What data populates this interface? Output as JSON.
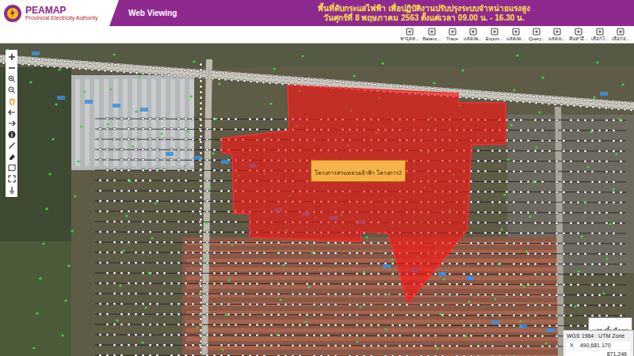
{
  "header": {
    "logo": "PEAMAP",
    "org": "Provincial Electricity Authority",
    "app": "Web Viewing",
    "title_line1": "พื้นที่ดับกระแสไฟฟ้า เพื่อปฏิบัติงานปรับปรุงระบบจำหน่ายแรงสูง",
    "title_line2": "วันศุกร์ที่ 8 พฤษภาคม 2563 ตั้งแต่เวลา 09.00 น. - 16.30 น."
  },
  "toolbar": [
    {
      "label": "หาจุดท..."
    },
    {
      "label": "Balanc..."
    },
    {
      "label": "Trace"
    },
    {
      "label": "แสดงผ..."
    },
    {
      "label": "Export..."
    },
    {
      "label": "แสดงผ..."
    },
    {
      "label": "Query..."
    },
    {
      "label": "แสดงเ..."
    },
    {
      "label": "ค้นหาอี..."
    },
    {
      "label": "เลือกโ..."
    },
    {
      "label": "เลือกอ..."
    }
  ],
  "map": {
    "area_label": "โครงการสวนหลวงเจ้าฟ้า โครงการ2"
  },
  "basemap_toggle": "แสดงพื้นที่ภาพ",
  "coords": {
    "system": "WGS 1984 : UTM Zone",
    "x_label": "X",
    "x": "490,681.170",
    "y": "871,246"
  }
}
